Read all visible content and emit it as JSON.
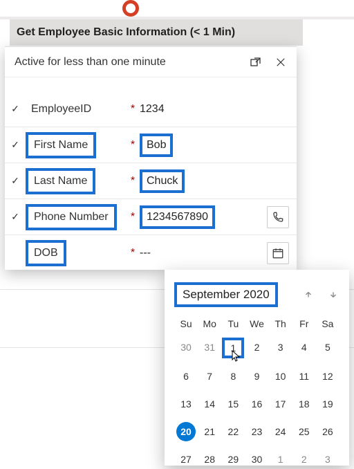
{
  "step": {
    "title": "Get Employee Basic Information  (< 1 Min)"
  },
  "panel": {
    "subtitle": "Active for less than one minute",
    "fields": [
      {
        "label": "EmployeeID",
        "required": "*",
        "value": "1234",
        "check": "✓",
        "hi_label": false,
        "hi_val": false,
        "right_icon": ""
      },
      {
        "label": "First Name",
        "required": "*",
        "value": "Bob",
        "check": "✓",
        "hi_label": true,
        "hi_val": true,
        "right_icon": ""
      },
      {
        "label": "Last Name",
        "required": "*",
        "value": "Chuck",
        "check": "✓",
        "hi_label": true,
        "hi_val": true,
        "right_icon": ""
      },
      {
        "label": "Phone Number",
        "required": "*",
        "value": "1234567890",
        "check": "✓",
        "hi_label": true,
        "hi_val": true,
        "right_icon": "phone"
      },
      {
        "label": "DOB",
        "required": "*",
        "value": "---",
        "check": "",
        "hi_label": true,
        "hi_val": false,
        "right_icon": "calendar"
      }
    ]
  },
  "calendar": {
    "month_label": "September 2020",
    "dow": [
      "Su",
      "Mo",
      "Tu",
      "We",
      "Th",
      "Fr",
      "Sa"
    ],
    "weeks": [
      [
        {
          "d": "30",
          "o": true
        },
        {
          "d": "31",
          "o": true
        },
        {
          "d": "1",
          "sel": true
        },
        {
          "d": "2"
        },
        {
          "d": "3"
        },
        {
          "d": "4"
        },
        {
          "d": "5"
        }
      ],
      [
        {
          "d": "6"
        },
        {
          "d": "7"
        },
        {
          "d": "8"
        },
        {
          "d": "9"
        },
        {
          "d": "10"
        },
        {
          "d": "11"
        },
        {
          "d": "12"
        }
      ],
      [
        {
          "d": "13"
        },
        {
          "d": "14"
        },
        {
          "d": "15"
        },
        {
          "d": "16"
        },
        {
          "d": "17"
        },
        {
          "d": "18"
        },
        {
          "d": "19"
        }
      ],
      [
        {
          "d": "20",
          "today": true
        },
        {
          "d": "21"
        },
        {
          "d": "22"
        },
        {
          "d": "23"
        },
        {
          "d": "24"
        },
        {
          "d": "25"
        },
        {
          "d": "26"
        }
      ],
      [
        {
          "d": "27"
        },
        {
          "d": "28"
        },
        {
          "d": "29"
        },
        {
          "d": "30"
        },
        {
          "d": "1",
          "o": true
        },
        {
          "d": "2",
          "o": true
        },
        {
          "d": "3",
          "o": true
        }
      ]
    ]
  }
}
